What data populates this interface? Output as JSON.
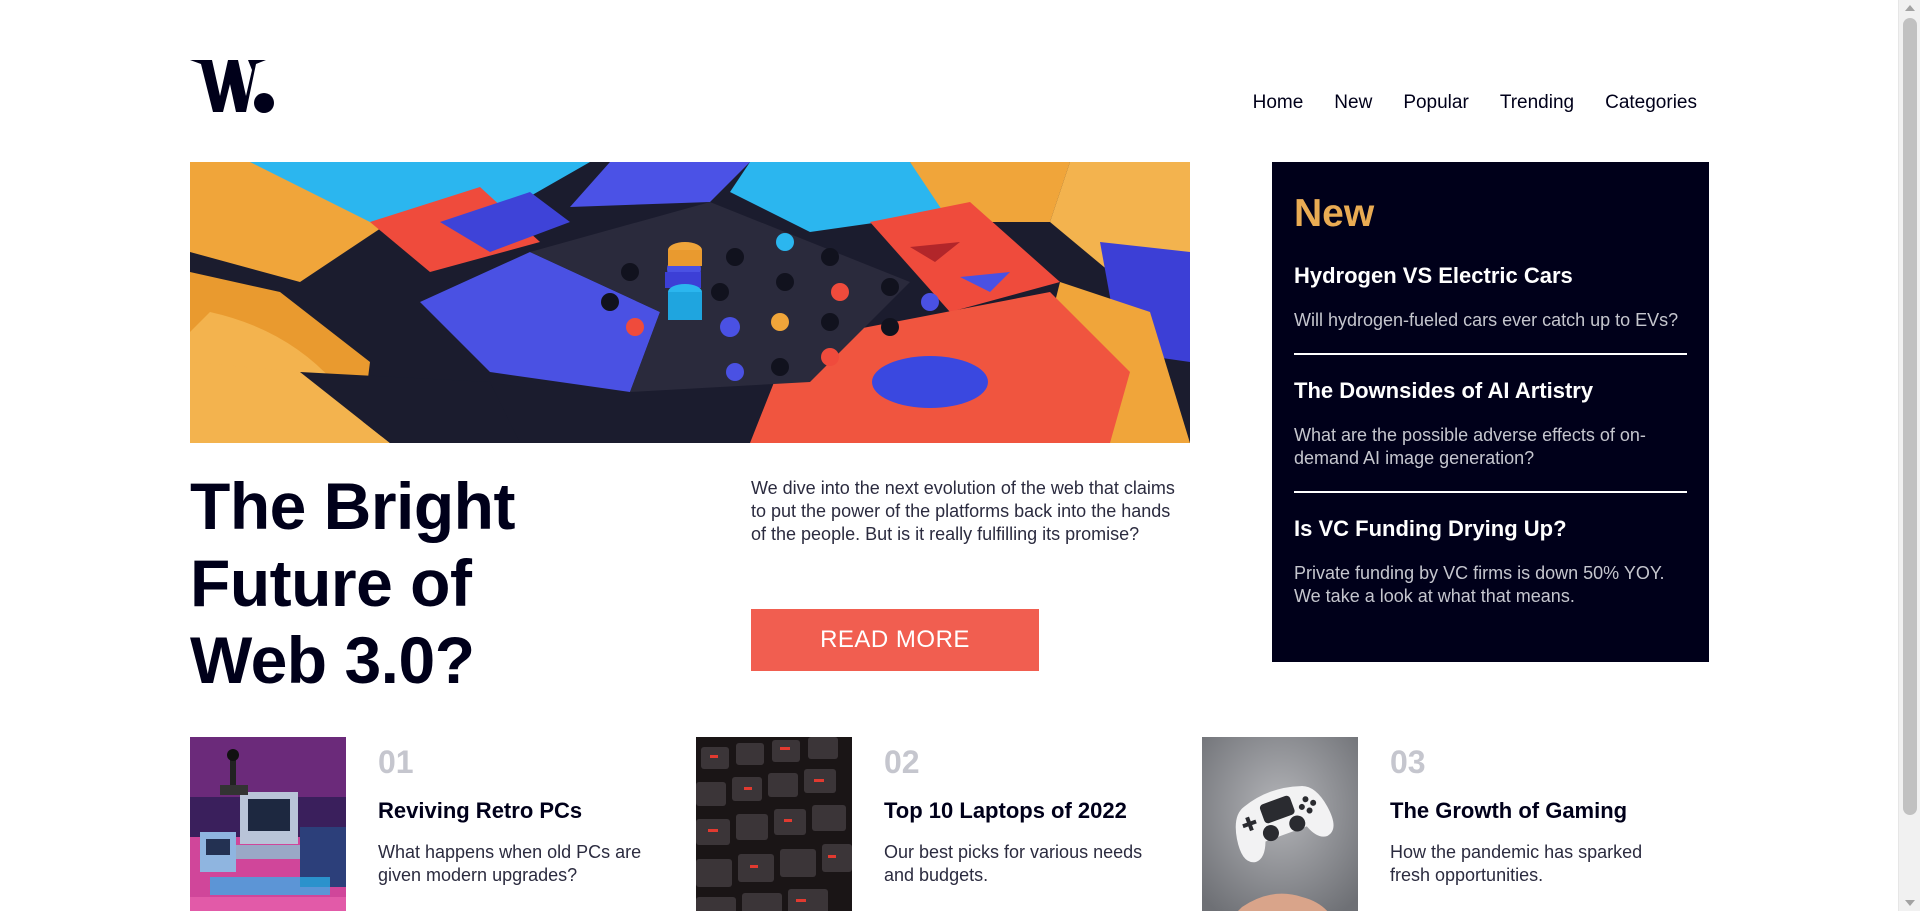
{
  "brand": {
    "logo_text": "W.",
    "logo_color": "#00001a"
  },
  "nav": {
    "items": [
      {
        "label": "Home"
      },
      {
        "label": "New"
      },
      {
        "label": "Popular"
      },
      {
        "label": "Trending"
      },
      {
        "label": "Categories"
      }
    ]
  },
  "hero": {
    "image_icon": "abstract-3d-blocks-image",
    "title": "The Bright Future of Web 3.0?",
    "description": "We dive into the next evolution of the web that claims to put the power of the platforms back into the hands of the people. But is it really fulfilling its promise?",
    "cta_label": "READ MORE",
    "cta_color": "#f15e50"
  },
  "new_panel": {
    "heading": "New",
    "heading_color": "#e9ab53",
    "background": "#00001a",
    "items": [
      {
        "title": "Hydrogen VS Electric Cars",
        "description": "Will hydrogen-fueled cars ever catch up to EVs?"
      },
      {
        "title": "The Downsides of AI Artistry",
        "description": "What are the possible adverse effects of on-demand AI image generation?"
      },
      {
        "title": "Is VC Funding Drying Up?",
        "description": "Private funding by VC firms is down 50% YOY. We take a look at what that means."
      }
    ]
  },
  "cards": [
    {
      "number": "01",
      "title": "Reviving Retro PCs",
      "description": "What happens when old PCs are given modern upgrades?",
      "image_icon": "retro-pc-image"
    },
    {
      "number": "02",
      "title": "Top 10 Laptops of 2022",
      "description": "Our best picks for various needs and budgets.",
      "image_icon": "keyboard-image"
    },
    {
      "number": "03",
      "title": "The Growth of Gaming",
      "description": "How the pandemic has sparked fresh opportunities.",
      "image_icon": "game-controller-image"
    }
  ]
}
